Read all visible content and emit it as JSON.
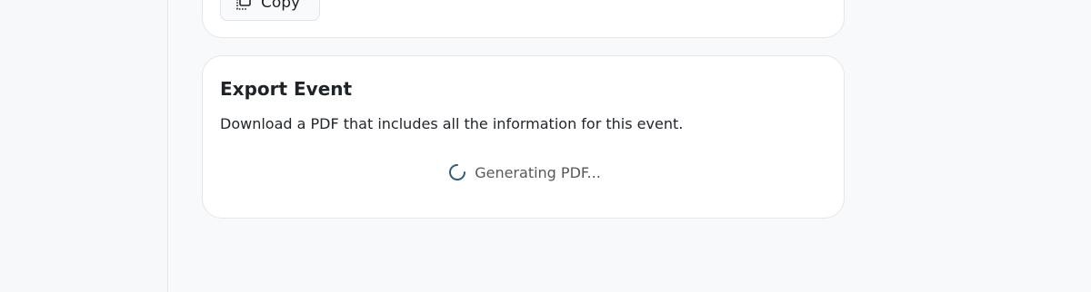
{
  "copy_card": {
    "copy_label": "Copy",
    "icon": "copy-icon"
  },
  "export_card": {
    "title": "Export Event",
    "description": "Download a PDF that includes all the information for this event.",
    "status_text": "Generating PDF...",
    "status_icon": "spinner-icon"
  },
  "colors": {
    "background": "#f8f9fa",
    "card": "#ffffff",
    "border": "#e4e7eb",
    "spinner": "#2f5d7c"
  }
}
